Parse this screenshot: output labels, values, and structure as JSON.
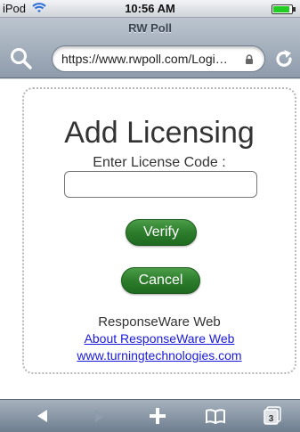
{
  "status": {
    "carrier": "iPod",
    "time": "10:56 AM"
  },
  "browser": {
    "page_title": "RW Poll",
    "url": "https://www.rwpoll.com/Logi…",
    "tab_count": "3"
  },
  "page": {
    "heading": "Add Licensing",
    "subheading": "Enter License Code :",
    "license_code_value": "",
    "verify_label": "Verify",
    "cancel_label": "Cancel",
    "app_name": "ResponseWare Web",
    "about_link": "About ResponseWare Web",
    "site_link": "www.turningtechnologies.com"
  },
  "icons": {
    "wifi": "wifi-icon",
    "battery": "battery-icon",
    "search": "search-icon",
    "lock": "lock-icon",
    "reload": "reload-icon",
    "back": "back-arrow-icon",
    "forward": "forward-arrow-icon",
    "add": "add-icon",
    "bookmarks": "bookmarks-icon",
    "tabs": "tabs-icon"
  },
  "colors": {
    "button_green": "#2d7d2c",
    "link_blue": "#1a1adc",
    "toolbar": "#8e9bab"
  }
}
